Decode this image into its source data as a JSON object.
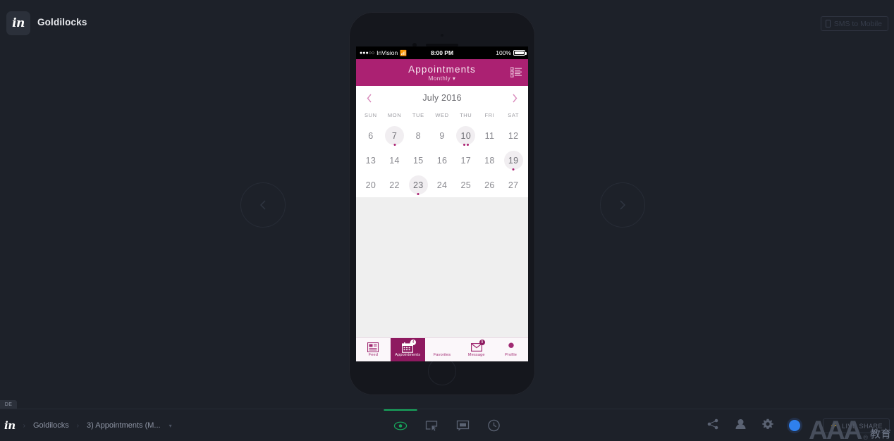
{
  "topbar": {
    "logo_text": "in",
    "project_name": "Goldilocks",
    "sms_button": "SMS to Mobile"
  },
  "navigation": {
    "prev_label": "‹",
    "next_label": "›"
  },
  "device": {
    "status_bar": {
      "signal_dots": "●●●○○",
      "carrier": "InVision",
      "wifi": "📶",
      "time": "8:00 PM",
      "battery_percent": "100%"
    },
    "app_header": {
      "title": "Appointments",
      "subtitle": "Monthly ▾",
      "agenda_icon": "list-view-icon"
    },
    "calendar": {
      "prev_month": "‹",
      "month_label": "July 2016",
      "next_month": "›",
      "weekdays": [
        "SUN",
        "MON",
        "TUE",
        "WED",
        "THU",
        "FRI",
        "SAT"
      ],
      "weeks": [
        [
          {
            "day": "6",
            "selected": false,
            "dots": 0
          },
          {
            "day": "7",
            "selected": true,
            "dots": 1
          },
          {
            "day": "8",
            "selected": false,
            "dots": 0
          },
          {
            "day": "9",
            "selected": false,
            "dots": 0
          },
          {
            "day": "10",
            "selected": true,
            "dots": 2
          },
          {
            "day": "11",
            "selected": false,
            "dots": 0
          },
          {
            "day": "12",
            "selected": false,
            "dots": 0
          }
        ],
        [
          {
            "day": "13",
            "selected": false,
            "dots": 0
          },
          {
            "day": "14",
            "selected": false,
            "dots": 0
          },
          {
            "day": "15",
            "selected": false,
            "dots": 0
          },
          {
            "day": "16",
            "selected": false,
            "dots": 0
          },
          {
            "day": "17",
            "selected": false,
            "dots": 0
          },
          {
            "day": "18",
            "selected": false,
            "dots": 0
          },
          {
            "day": "19",
            "selected": true,
            "dots": 1
          }
        ],
        [
          {
            "day": "20",
            "selected": false,
            "dots": 0
          },
          {
            "day": "22",
            "selected": false,
            "dots": 0
          },
          {
            "day": "23",
            "selected": true,
            "dots": 1
          },
          {
            "day": "24",
            "selected": false,
            "dots": 0
          },
          {
            "day": "25",
            "selected": false,
            "dots": 0
          },
          {
            "day": "26",
            "selected": false,
            "dots": 0
          },
          {
            "day": "27",
            "selected": false,
            "dots": 0
          }
        ]
      ]
    },
    "tabs": [
      {
        "label": "Feed",
        "icon": "feed-icon",
        "active": false,
        "badge": ""
      },
      {
        "label": "Appointments",
        "icon": "calendar-icon",
        "active": true,
        "badge": "4"
      },
      {
        "label": "Favorites",
        "icon": "heart-icon",
        "active": false,
        "badge": ""
      },
      {
        "label": "Message",
        "icon": "envelope-icon",
        "active": false,
        "badge": "9"
      },
      {
        "label": "Profile",
        "icon": "person-icon",
        "active": false,
        "badge": ""
      }
    ]
  },
  "bottombar": {
    "tab_stub": "DE",
    "breadcrumb": {
      "home_logo": "in",
      "separator": "›",
      "project": "Goldilocks",
      "screen": "3) Appointments (M...",
      "caret": "▾"
    },
    "tools": [
      {
        "name": "preview-eye-icon",
        "active": true
      },
      {
        "name": "build-mode-icon",
        "active": false
      },
      {
        "name": "comment-icon",
        "active": false
      },
      {
        "name": "history-icon",
        "active": false
      }
    ],
    "right_tools": [
      {
        "name": "share-icon"
      },
      {
        "name": "user-icon"
      },
      {
        "name": "settings-gear-icon"
      },
      {
        "name": "account-avatar"
      }
    ],
    "live_share": "LIVE SHARE"
  },
  "watermark": {
    "main": "AAA",
    "sup": "®",
    "cn": "教育"
  },
  "colors": {
    "app_bg": "#1d2129",
    "brand_pink": "#ab2172",
    "brand_pink_dark": "#8e1a60",
    "accent_green": "#17a85c",
    "avatar_blue": "#2f80ed"
  }
}
